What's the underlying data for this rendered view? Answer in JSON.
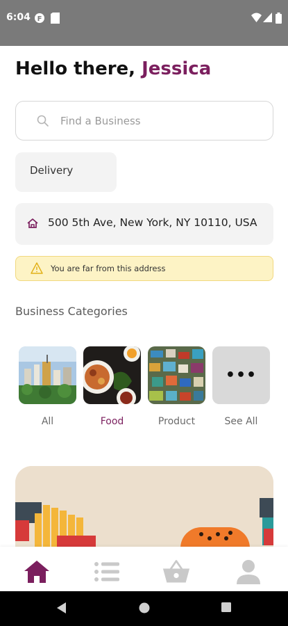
{
  "status_bar": {
    "time": "6:04"
  },
  "greeting": {
    "prefix": "Hello there,",
    "name": "Jessica"
  },
  "search": {
    "placeholder": "Find a Business"
  },
  "mode": {
    "label": "Delivery"
  },
  "address": {
    "text": "500 5th Ave, New York, NY 10110, USA"
  },
  "warning": {
    "text": "You are far from this address"
  },
  "categories": {
    "title": "Business Categories",
    "items": [
      {
        "label": "All",
        "selected": false
      },
      {
        "label": "Food",
        "selected": true
      },
      {
        "label": "Product",
        "selected": false
      },
      {
        "label": "See All",
        "selected": false
      }
    ]
  },
  "bottom_nav": {
    "items": [
      {
        "icon": "home-icon",
        "active": true
      },
      {
        "icon": "list-icon",
        "active": false
      },
      {
        "icon": "basket-icon",
        "active": false
      },
      {
        "icon": "profile-icon",
        "active": false
      }
    ]
  },
  "colors": {
    "accent": "#7b1f5e",
    "inactive": "#c9c9c9",
    "warning_bg": "#fdf3c5"
  }
}
